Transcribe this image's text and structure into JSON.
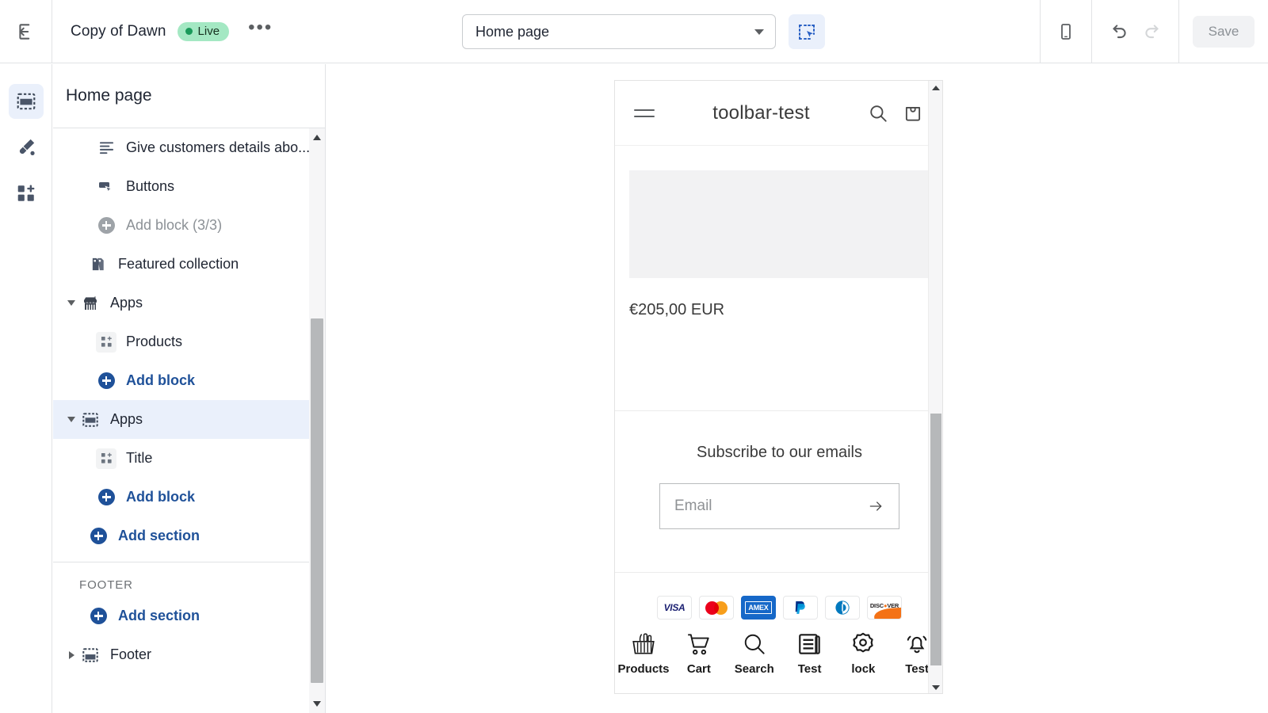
{
  "topbar": {
    "exit_icon": "exit-icon",
    "theme_name": "Copy of Dawn",
    "live_badge": "Live",
    "more_actions": "•••",
    "page_selector": {
      "value": "Home page",
      "caret_icon": "chevron-down-icon"
    },
    "inspect_icon": "select-region-icon",
    "device_icon": "mobile-device-icon",
    "undo_icon": "undo-icon",
    "redo_icon": "redo-icon",
    "save_label": "Save"
  },
  "rail": {
    "items": [
      {
        "icon": "sections-icon",
        "name": "sections",
        "active": true
      },
      {
        "icon": "theme-settings-paintbrush-icon",
        "name": "theme-settings",
        "active": false
      },
      {
        "icon": "app-embeds-icon",
        "name": "app-embeds",
        "active": false
      }
    ]
  },
  "sidebar": {
    "title": "Home page",
    "tree": [
      {
        "label": "Give customers details abo...",
        "icon": "text-block-icon",
        "indent": 2,
        "style": "normal",
        "toggle": "none"
      },
      {
        "label": "Buttons",
        "icon": "buttons-block-icon",
        "indent": 2,
        "style": "normal",
        "toggle": "none"
      },
      {
        "label": "Add block (3/3)",
        "icon": "plus-circle-gray-icon",
        "indent": 2,
        "style": "muted",
        "toggle": "none"
      },
      {
        "label": "Featured collection",
        "icon": "collection-tag-icon",
        "indent": 1,
        "style": "normal",
        "toggle": "none"
      },
      {
        "label": "Apps",
        "icon": "app-store-icon",
        "indent": 1,
        "style": "normal",
        "toggle": "down"
      },
      {
        "label": "Products",
        "icon": "app-block-icon",
        "indent": 2,
        "style": "normal",
        "toggle": "none"
      },
      {
        "label": "Add block",
        "icon": "plus-circle-blue-icon",
        "indent": 2,
        "style": "link",
        "toggle": "none"
      },
      {
        "label": "Apps",
        "icon": "section-icon",
        "indent": 1,
        "style": "normal",
        "toggle": "down",
        "selected": true
      },
      {
        "label": "Title",
        "icon": "app-block-icon",
        "indent": 2,
        "style": "normal",
        "toggle": "none"
      },
      {
        "label": "Add block",
        "icon": "plus-circle-blue-icon",
        "indent": 2,
        "style": "link",
        "toggle": "none"
      },
      {
        "label": "Add section",
        "icon": "plus-circle-blue-icon",
        "indent": 1,
        "style": "link",
        "toggle": "none"
      }
    ],
    "footer_group": {
      "label": "FOOTER",
      "rows": [
        {
          "label": "Add section",
          "icon": "plus-circle-blue-icon",
          "indent": 1,
          "style": "link",
          "toggle": "none"
        },
        {
          "label": "Footer",
          "icon": "section-icon",
          "indent": 1,
          "style": "normal",
          "toggle": "right"
        }
      ]
    }
  },
  "preview": {
    "store_name": "toolbar-test",
    "menu_icon": "hamburger-menu-icon",
    "search_icon": "search-icon",
    "cart_icon": "shopping-bag-icon",
    "price": "€205,00 EUR",
    "subscribe_title": "Subscribe to our emails",
    "email_placeholder": "Email",
    "email_submit_icon": "arrow-right-icon",
    "payment_methods": [
      "VISA",
      "Mastercard",
      "AMEX",
      "PayPal",
      "Diners Club",
      "DISCOVER"
    ],
    "payment_labels": {
      "visa": "VISA",
      "amex": "AMEX",
      "paypal": "P",
      "discover": "DISC",
      "discover_o": "O",
      "discover_tail": "VER"
    },
    "toolbar": [
      {
        "label": "Products",
        "icon": "basket-icon"
      },
      {
        "label": "Cart",
        "icon": "shopping-cart-icon"
      },
      {
        "label": "Search",
        "icon": "search-icon"
      },
      {
        "label": "Test",
        "icon": "document-icon"
      },
      {
        "label": "lock",
        "icon": "gear-icon"
      },
      {
        "label": "Test",
        "icon": "bell-icon"
      }
    ]
  },
  "colors": {
    "accent_blue": "#1f5199",
    "selected_bg": "#eaf0fb",
    "live_green": "#a4e8c3",
    "border": "#e1e3e5"
  }
}
